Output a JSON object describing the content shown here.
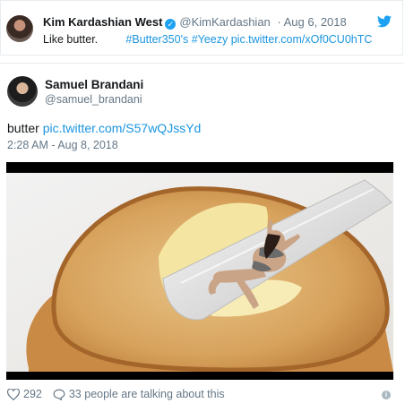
{
  "quoted_tweet": {
    "name": "Kim Kardashian West",
    "handle": "@KimKardashian",
    "date": "· Aug 6, 2018",
    "text_plain": "Like butter.",
    "hashtags": "#Butter350's #Yeezy",
    "link": "pic.twitter.com/xOf0CU0hTC"
  },
  "tweet": {
    "name": "Samuel Brandani",
    "handle": "@samuel_brandani",
    "text_plain": "butter",
    "link": "pic.twitter.com/S57wQJssYd",
    "timestamp": "2:28 AM - Aug 8, 2018"
  },
  "footer": {
    "likes": "292",
    "talking": "33 people are talking about this"
  },
  "colors": {
    "link": "#1b95e0",
    "verified": "#1da1f2",
    "muted": "#657786"
  },
  "icons": [
    "verified-badge-icon",
    "twitter-bird-icon",
    "heart-icon",
    "comment-icon",
    "info-icon"
  ]
}
